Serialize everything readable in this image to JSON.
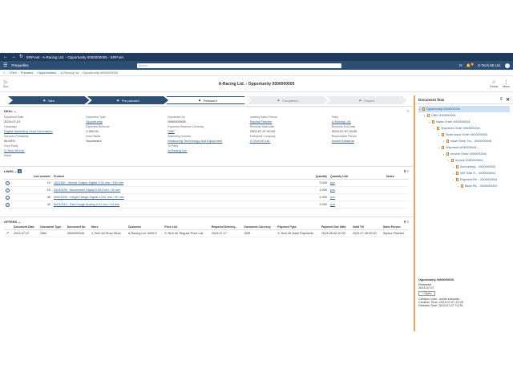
{
  "window": {
    "title": "ERP.net - A-Racing Ltd. - Opportunity 0000000005 - ERP.net"
  },
  "topbar": {
    "app_name": "Prequelles",
    "search_placeholder": "Search",
    "notifications_count": "9",
    "user": "X-Tech MI Ltd."
  },
  "breadcrumb": {
    "home": "CRM",
    "section": "Presales",
    "list": "Opportunities",
    "current": "A-Racing Ltd. - Opportunity 0000000005"
  },
  "toolbar": {
    "run_label": "Run",
    "title": "A-Racing Ltd. - Opportunity 0000000005",
    "actions": [
      {
        "label": "Follow"
      },
      {
        "label": "Menu"
      }
    ]
  },
  "stages": [
    {
      "label": "New",
      "state": "done"
    },
    {
      "label": "Pre-planned",
      "state": "done"
    },
    {
      "label": "Released",
      "state": "active"
    },
    {
      "label": "Completed",
      "state": "todo"
    },
    {
      "label": "Closed",
      "state": "todo"
    }
  ],
  "deal": {
    "heading": "DEAL",
    "fields": [
      {
        "label": "Document Date",
        "value": "2023-07-07",
        "link": false
      },
      {
        "label": "Document Type",
        "value": "Opportunity",
        "link": true
      },
      {
        "label": "Document No",
        "value": "0000000005",
        "link": false
      },
      {
        "label": "Leading Sales Person",
        "value": "Sepina Fletcher",
        "link": true
      },
      {
        "label": "Party",
        "value": "A-Racing Ltd.",
        "link": true
      },
      {
        "label": "Campaign",
        "value": "Digital Marketing Lead Generation",
        "link": true
      },
      {
        "label": "Expected Revenue",
        "value": "1,500.00",
        "link": false
      },
      {
        "label": "Expected Revenue Currency",
        "value": "GBP",
        "link": true
      },
      {
        "label": "Revenue Start Date",
        "value": "2023-07-07 00:00",
        "link": false
      },
      {
        "label": "Revenue End Date",
        "value": "2023-07-07 00:00",
        "link": false
      },
      {
        "label": "Success Probability",
        "value": "95.00%",
        "link": false
      },
      {
        "label": "Deal Status",
        "value": "Successful",
        "link": false
      },
      {
        "label": "Marketing Solution",
        "value": "Measuring Technology and Equipment",
        "link": true
      },
      {
        "label": "Enterprise Company",
        "value": "X-Tech MI Ltd.",
        "link": true
      },
      {
        "label": "Responsible Person",
        "value": "Daniel Edwards",
        "link": true
      },
      {
        "label": "From Party",
        "value": "X-Tech MI Ltd.",
        "link": true
      },
      {
        "label": "",
        "value": "",
        "link": false
      },
      {
        "label": "To Party",
        "value": "A-Racing Ltd.",
        "link": true
      },
      {
        "label": "",
        "value": "",
        "link": false
      },
      {
        "label": "",
        "value": "",
        "link": false
      },
      {
        "label": "Notes",
        "value": "",
        "link": false
      }
    ]
  },
  "lines": {
    "heading": "LINES",
    "count": "4",
    "columns": [
      "Line number",
      "Product",
      "Quantity",
      "Quantity Unit",
      "Notes"
    ],
    "rows": [
      {
        "line": "10",
        "product": "1001150 : Vernier Caliper Digital 0.01 mm / 150 mm",
        "qty": "3.000",
        "unit": "pcs"
      },
      {
        "line": "20",
        "product": "20010030 : Micrometer Digital 0.001 mm / 30 mm",
        "qty": "1.000",
        "unit": "pcs"
      },
      {
        "line": "30",
        "product": "50001500 : Height Gauge Digital 0.001 mm / 50 mm",
        "qty": "1.000",
        "unit": "pcs"
      },
      {
        "line": "40",
        "product": "60010010 : Dial Gauge Analog 0.01 mm / 10 mm",
        "qty": "2.000",
        "unit": "pcs"
      }
    ]
  },
  "offers": {
    "heading": "OFFERS",
    "columns": [
      "Document Date",
      "Document Type",
      "Document No",
      "Store",
      "Customer",
      "Price List",
      "Required Delivery...",
      "Document Currency",
      "Payment Type",
      "Payment Due Date",
      "Valid Till",
      "Sales Person"
    ],
    "rows": [
      [
        "2023-07-07",
        "Offer",
        "0000000006",
        "X-Tech MI Shop Store",
        "A-Racing Ltd. #00017",
        "X-Tech MI Regular Price List",
        "2023-07-17",
        "GBP",
        "X-Tech MI Bank Payments",
        "2023-08-06 00:00",
        "2023-07-28 00:00",
        "Sepina Fletcher"
      ]
    ]
  },
  "sidebar": {
    "title": "Document flow",
    "tree": [
      {
        "label": "Opportunity 0000000005",
        "level": 0,
        "selected": true
      },
      {
        "label": "Offer 0000000006",
        "level": 1
      },
      {
        "label": "Sales Order 0000000004",
        "level": 2
      },
      {
        "label": "Shipment Order 0000000004",
        "level": 3
      },
      {
        "label": "Store Issue Order 0000000004",
        "level": 4
      },
      {
        "label": "Issue Store Tra... 0000000006",
        "level": 5
      },
      {
        "label": "Shipment 0000000004",
        "level": 4
      },
      {
        "label": "Invoice Order 0000000004",
        "level": 5
      },
      {
        "label": "Invoice 0000000004",
        "level": 6
      },
      {
        "label": "Accounting... 0000000005",
        "level": 7
      },
      {
        "label": "VAT Sale E... 0000000004",
        "level": 7
      },
      {
        "label": "Payment Re... 0000000004",
        "level": 7
      },
      {
        "label": "Bank Pa... 0000000003",
        "level": 8
      }
    ],
    "detail": {
      "title": "Opportunity 0000000005",
      "state": "Released",
      "date": "2023-07-07",
      "open_label": "Open",
      "creation_user": "Creation User: daniel.edwards",
      "creation_time": "Creation Time: 2023-07-07 13:35",
      "release_time": "Release Time: 2023-07-07 13:35"
    }
  }
}
